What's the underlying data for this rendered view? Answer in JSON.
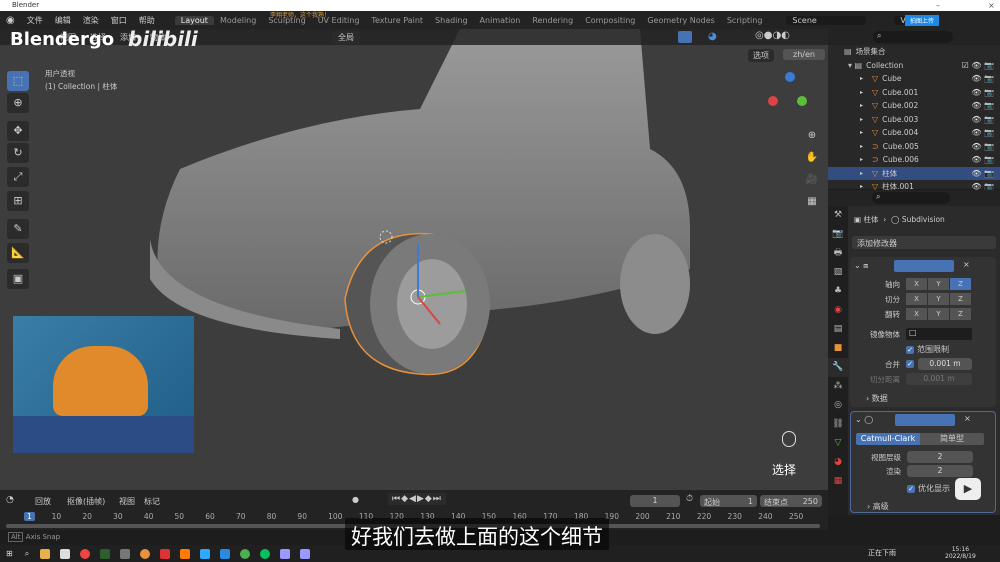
{
  "window": {
    "title": "Blender",
    "notice": "李翔老师，这个我熟！"
  },
  "menu": {
    "items": [
      "文件",
      "编辑",
      "渲染",
      "窗口",
      "帮助"
    ],
    "workspaces": [
      "Layout",
      "Modeling",
      "Sculpting",
      "UV Editing",
      "Texture Paint",
      "Shading",
      "Animation",
      "Rendering",
      "Compositing",
      "Geometry Nodes",
      "Scripting"
    ],
    "active_workspace": "Layout",
    "scene": "Scene",
    "view_layer": "Vie",
    "upload_badge": "拍图上传"
  },
  "watermark": {
    "brand": "Blendergo",
    "site": "bilibili"
  },
  "viewport": {
    "header_items": [
      "视图",
      "选择",
      "添加",
      "物体"
    ],
    "transform_orientation": "全局",
    "view_name": "用户透视",
    "collection_info": "(1) Collection | 柱体",
    "options_label": "选项",
    "lang_button": "zh/en",
    "gizmo_axes": [
      "X",
      "Y",
      "Z"
    ],
    "select_label": "选择"
  },
  "outliner": {
    "root": "场景集合",
    "collection": "Collection",
    "items": [
      {
        "name": "Cube",
        "selected": false
      },
      {
        "name": "Cube.001",
        "selected": false
      },
      {
        "name": "Cube.002",
        "selected": false
      },
      {
        "name": "Cube.003",
        "selected": false
      },
      {
        "name": "Cube.004",
        "selected": false
      },
      {
        "name": "Cube.005",
        "selected": false
      },
      {
        "name": "Cube.006",
        "selected": false
      },
      {
        "name": "柱体",
        "selected": true
      },
      {
        "name": "柱体.001",
        "selected": false
      }
    ]
  },
  "properties": {
    "object": "柱体",
    "modifier": "Subdivision",
    "add_modifier": "添加修改器",
    "mirror": {
      "axis_label": "轴向",
      "bisect_label": "切分",
      "flip_label": "翻转",
      "axes": [
        "X",
        "Y",
        "Z"
      ],
      "mirror_object_label": "镜像物体",
      "clipping_label": "范围限制",
      "merge_label": "合并",
      "merge_value": "0.001 m",
      "bisect_distance_label": "切分距离",
      "bisect_distance_value": "0.001 m",
      "data_label": "数据"
    },
    "subdivision": {
      "catmull": "Catmull-Clark",
      "simple": "简单型",
      "viewport_levels_label": "视图层级",
      "viewport_levels": "2",
      "render_label": "渲染",
      "render_levels": "2",
      "optimal_label": "优化显示",
      "advanced_label": "高级"
    }
  },
  "timeline": {
    "menus": [
      "回放",
      "抠像(插帧)",
      "视图",
      "标记"
    ],
    "current_frame": "1",
    "start_label": "起始",
    "start": "1",
    "end_label": "结束点",
    "end": "250",
    "ticks": [
      "1",
      "10",
      "20",
      "30",
      "40",
      "50",
      "60",
      "70",
      "80",
      "90",
      "100",
      "110",
      "120",
      "130",
      "140",
      "150",
      "160",
      "170",
      "180",
      "190",
      "200",
      "210",
      "220",
      "230",
      "240",
      "250"
    ]
  },
  "status": {
    "text": "Axis Snap",
    "key": "Alt"
  },
  "subtitle": "好我们去做上面的这个细节",
  "taskbar": {
    "ime": "正在下雨",
    "time": "15:16",
    "date": "2022/8/19"
  },
  "colors": {
    "accent": "#4772b3",
    "selection_orange": "#e8923b",
    "viewport_bg": "#3d3d3d"
  }
}
